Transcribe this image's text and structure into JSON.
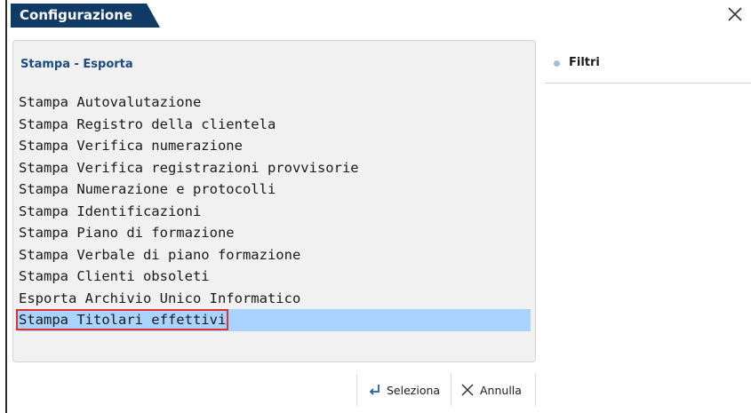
{
  "window": {
    "title": "Configurazione"
  },
  "panel": {
    "title": "Stampa - Esporta",
    "items": [
      "Stampa Autovalutazione",
      "Stampa Registro della clientela",
      "Stampa Verifica numerazione",
      "Stampa Verifica registrazioni provvisorie",
      "Stampa Numerazione e protocolli",
      "Stampa Identificazioni",
      "Stampa Piano di formazione",
      "Stampa Verbale di piano formazione",
      "Stampa Clienti obsoleti",
      "Esporta Archivio Unico Informatico",
      "Stampa Titolari effettivi"
    ],
    "selected_index": 10
  },
  "side": {
    "filter_label": "Filtri"
  },
  "buttons": {
    "select_label": "Seleziona",
    "cancel_label": "Annulla"
  },
  "colors": {
    "title_bg": "#0f3a66",
    "selection": "#a9d4ff",
    "highlight_box": "#e03131"
  }
}
